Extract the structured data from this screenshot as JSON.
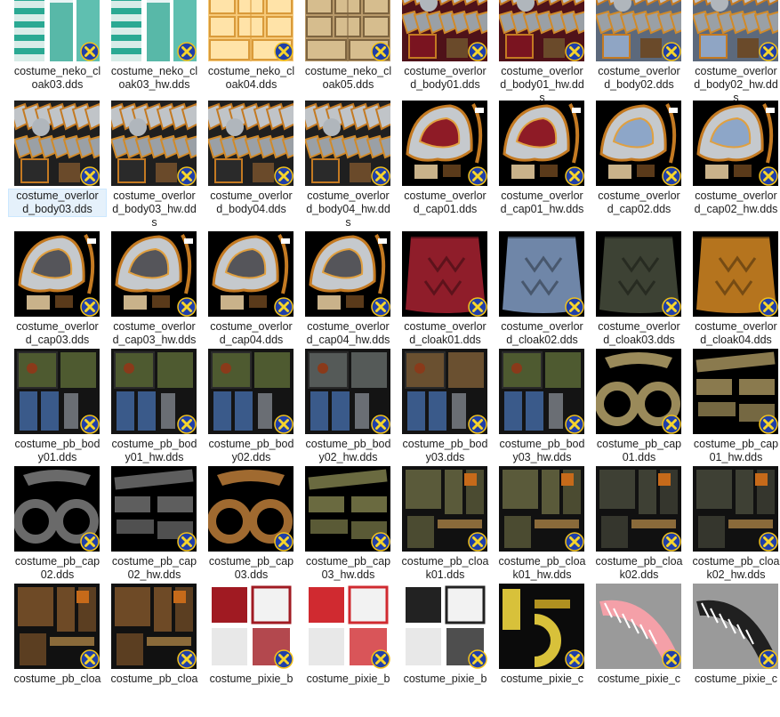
{
  "colors": {
    "badge_fill": "#1f3fa8",
    "badge_ring": "#f2c21a",
    "badge_x": "#f7d52b",
    "selection": "#cce8ff"
  },
  "files": [
    {
      "lines": [
        "costume_neko_cl",
        "oak03.dds"
      ],
      "theme": "cloak-teal"
    },
    {
      "lines": [
        "costume_neko_cl",
        "oak03_hw.dds"
      ],
      "theme": "cloak-teal"
    },
    {
      "lines": [
        "costume_neko_cl",
        "oak04.dds"
      ],
      "theme": "gold-grid"
    },
    {
      "lines": [
        "costume_neko_cl",
        "oak05.dds"
      ],
      "theme": "brown-grid"
    },
    {
      "lines": [
        "costume_overlor",
        "d_body01.dds"
      ],
      "theme": "overlord-red"
    },
    {
      "lines": [
        "costume_overlor",
        "d_body01_hw.dd",
        "s"
      ],
      "theme": "overlord-red"
    },
    {
      "lines": [
        "costume_overlor",
        "d_body02.dds"
      ],
      "theme": "overlord-blue"
    },
    {
      "lines": [
        "costume_overlor",
        "d_body02_hw.dd",
        "s"
      ],
      "theme": "overlord-blue"
    },
    {
      "lines": [
        "costume_overlor",
        "d_body03.dds"
      ],
      "theme": "overlord-dark",
      "selected": true
    },
    {
      "lines": [
        "costume_overlor",
        "d_body03_hw.dd",
        "s"
      ],
      "theme": "overlord-dark"
    },
    {
      "lines": [
        "costume_overlor",
        "d_body04.dds"
      ],
      "theme": "overlord-dark"
    },
    {
      "lines": [
        "costume_overlor",
        "d_body04_hw.dd",
        "s"
      ],
      "theme": "overlord-dark"
    },
    {
      "lines": [
        "costume_overlor",
        "d_cap01.dds"
      ],
      "theme": "cap-red"
    },
    {
      "lines": [
        "costume_overlor",
        "d_cap01_hw.dds"
      ],
      "theme": "cap-red"
    },
    {
      "lines": [
        "costume_overlor",
        "d_cap02.dds"
      ],
      "theme": "cap-blue"
    },
    {
      "lines": [
        "costume_overlor",
        "d_cap02_hw.dds"
      ],
      "theme": "cap-blue"
    },
    {
      "lines": [
        "costume_overlor",
        "d_cap03.dds"
      ],
      "theme": "cap-silver"
    },
    {
      "lines": [
        "costume_overlor",
        "d_cap03_hw.dds"
      ],
      "theme": "cap-silver"
    },
    {
      "lines": [
        "costume_overlor",
        "d_cap04.dds"
      ],
      "theme": "cap-silver"
    },
    {
      "lines": [
        "costume_overlor",
        "d_cap04_hw.dds"
      ],
      "theme": "cap-silver"
    },
    {
      "lines": [
        "costume_overlor",
        "d_cloak01.dds"
      ],
      "theme": "cloak-red"
    },
    {
      "lines": [
        "costume_overlor",
        "d_cloak02.dds"
      ],
      "theme": "cloak-blue"
    },
    {
      "lines": [
        "costume_overlor",
        "d_cloak03.dds"
      ],
      "theme": "cloak-olive"
    },
    {
      "lines": [
        "costume_overlor",
        "d_cloak04.dds"
      ],
      "theme": "cloak-orange"
    },
    {
      "lines": [
        "costume_pb_bod",
        "y01.dds"
      ],
      "theme": "pb-green"
    },
    {
      "lines": [
        "costume_pb_bod",
        "y01_hw.dds"
      ],
      "theme": "pb-green"
    },
    {
      "lines": [
        "costume_pb_bod",
        "y02.dds"
      ],
      "theme": "pb-green"
    },
    {
      "lines": [
        "costume_pb_bod",
        "y02_hw.dds"
      ],
      "theme": "pb-gray"
    },
    {
      "lines": [
        "costume_pb_bod",
        "y03.dds"
      ],
      "theme": "pb-brown"
    },
    {
      "lines": [
        "costume_pb_bod",
        "y03_hw.dds"
      ],
      "theme": "pb-green"
    },
    {
      "lines": [
        "costume_pb_cap",
        "01.dds"
      ],
      "theme": "ring-khaki"
    },
    {
      "lines": [
        "costume_pb_cap",
        "01_hw.dds"
      ],
      "theme": "strips-khaki"
    },
    {
      "lines": [
        "costume_pb_cap",
        "02.dds"
      ],
      "theme": "ring-gray"
    },
    {
      "lines": [
        "costume_pb_cap",
        "02_hw.dds"
      ],
      "theme": "strips-gray"
    },
    {
      "lines": [
        "costume_pb_cap",
        "03.dds"
      ],
      "theme": "ring-brown"
    },
    {
      "lines": [
        "costume_pb_cap",
        "03_hw.dds"
      ],
      "theme": "strips-olive"
    },
    {
      "lines": [
        "costume_pb_cloa",
        "k01.dds"
      ],
      "theme": "pbcloak-olive"
    },
    {
      "lines": [
        "costume_pb_cloa",
        "k01_hw.dds"
      ],
      "theme": "pbcloak-olive"
    },
    {
      "lines": [
        "costume_pb_cloa",
        "k02.dds"
      ],
      "theme": "pbcloak-dark"
    },
    {
      "lines": [
        "costume_pb_cloa",
        "k02_hw.dds"
      ],
      "theme": "pbcloak-dark"
    },
    {
      "lines": [
        "costume_pb_cloa"
      ],
      "theme": "pbcloak-brown"
    },
    {
      "lines": [
        "costume_pb_cloa"
      ],
      "theme": "pbcloak-brown"
    },
    {
      "lines": [
        "costume_pixie_b"
      ],
      "theme": "pixie-red"
    },
    {
      "lines": [
        "costume_pixie_b"
      ],
      "theme": "pixie-redwhite"
    },
    {
      "lines": [
        "costume_pixie_b"
      ],
      "theme": "pixie-bw"
    },
    {
      "lines": [
        "costume_pixie_c"
      ],
      "theme": "pixie-gold"
    },
    {
      "lines": [
        "costume_pixie_c"
      ],
      "theme": "pixie-pink"
    },
    {
      "lines": [
        "costume_pixie_c"
      ],
      "theme": "pixie-black"
    }
  ]
}
